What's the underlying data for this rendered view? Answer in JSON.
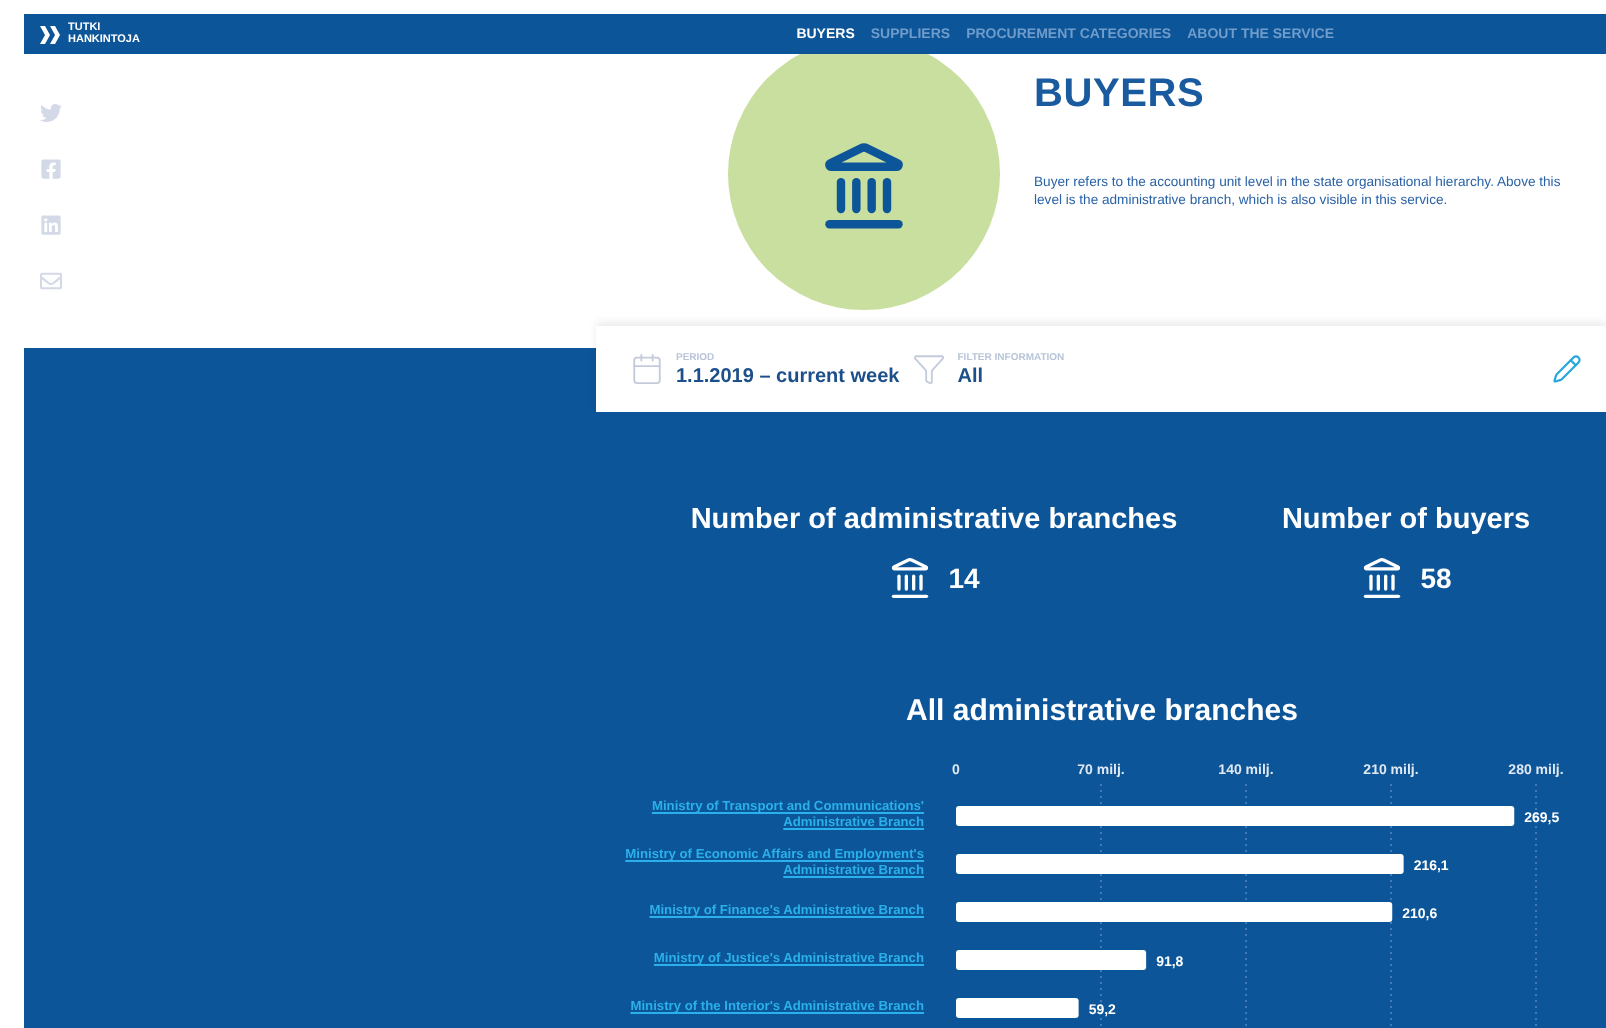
{
  "nav": {
    "logo_lines": [
      "TUTKI",
      "HANKINTOJA"
    ],
    "links": [
      {
        "label": "BUYERS",
        "selected": true
      },
      {
        "label": "SUPPLIERS",
        "selected": false
      },
      {
        "label": "PROCUREMENT CATEGORIES",
        "selected": false
      },
      {
        "label": "ABOUT THE SERVICE",
        "selected": false
      }
    ]
  },
  "share": [
    {
      "kind": "twitter"
    },
    {
      "kind": "facebook"
    },
    {
      "kind": "linkedin"
    },
    {
      "kind": "email"
    }
  ],
  "hero": {
    "title": "BUYERS",
    "description": "Buyer refers to the accounting unit level in the state organisational hierarchy. Above this level is the administrative branch, which is also visible in this service."
  },
  "filters": [
    {
      "kind": "period",
      "label": "PERIOD",
      "value": "1.1.2019 – current week"
    },
    {
      "kind": "filter",
      "label": "FILTER INFORMATION",
      "value": "All"
    }
  ],
  "stats": [
    {
      "label": "Number of administrative branches",
      "value": "14"
    },
    {
      "label": "Number of buyers",
      "value": "58"
    }
  ],
  "chart": {
    "chart_data": {
      "type": "bar",
      "orientation": "horizontal",
      "title": "All administrative branches",
      "categories": [
        "Ministry of Transport and Communications' Administrative Branch",
        "Ministry of Economic Affairs and Employment's Administrative Branch",
        "Ministry of Finance's Administrative Branch",
        "Ministry of Justice's Administrative Branch",
        "Ministry of the Interior's Administrative Branch"
      ],
      "values": [
        269.5,
        216.1,
        210.6,
        91.8,
        59.2
      ],
      "value_labels": [
        "269,5",
        "216,1",
        "210,6",
        "91,8",
        "59,2"
      ],
      "xlim": [
        0,
        280
      ],
      "grid": true,
      "xticks": [
        {
          "value": 0,
          "label": "0"
        },
        {
          "value": 70,
          "label": "70 milj."
        },
        {
          "value": 140,
          "label": "140 milj."
        },
        {
          "value": 210,
          "label": "210 milj."
        },
        {
          "value": 280,
          "label": "280 milj."
        }
      ]
    }
  }
}
